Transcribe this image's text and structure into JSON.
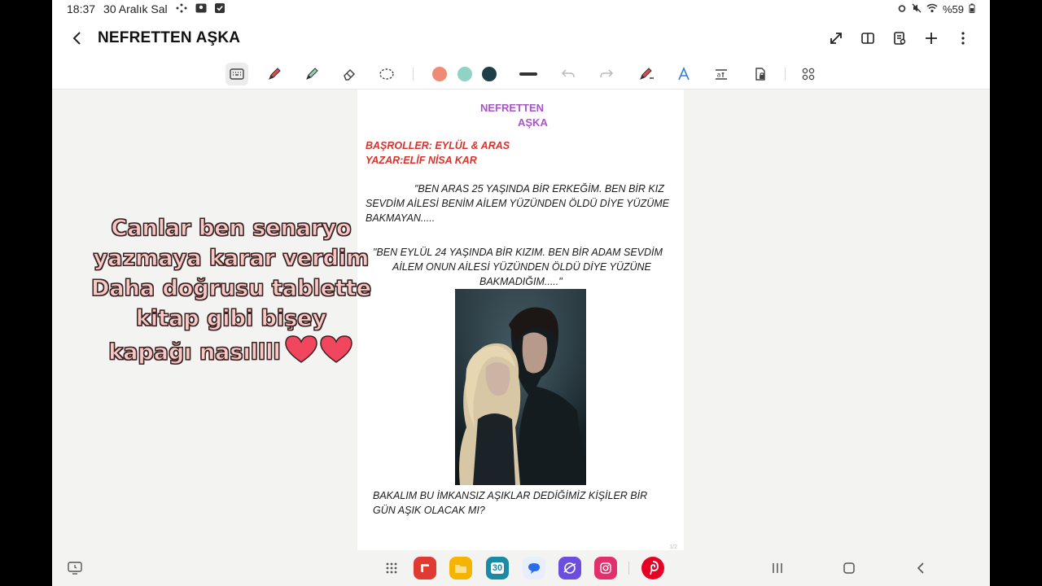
{
  "status_bar": {
    "time": "18:37",
    "date": "30 Aralık Sal",
    "battery": "%59"
  },
  "header": {
    "title": "NEFRETTEN AŞKA"
  },
  "toolbar": {
    "colors": [
      "#ef8a75",
      "#8fd3c4",
      "#1f3e47"
    ]
  },
  "page": {
    "title_line1": "NEFRETTEN",
    "title_line2": "AŞKA",
    "cast": "BAŞROLLER: EYLÜL & ARAS",
    "author": "YAZAR:ELİF NİSA KAR",
    "para1_line1": "\"BEN ARAS 25 YAŞINDA BİR ERKEĞİM. BEN BİR KIZ",
    "para1_line2": "SEVDİM AİLESİ BENİM AİLEM YÜZÜNDEN ÖLDÜ DİYE YÜZÜME",
    "para1_line3": "BAKMAYAN.....",
    "para2_line1": "\"BEN EYLÜL 24 YAŞINDA BİR KIZIM. BEN BİR ADAM SEVDİM",
    "para2_line2": "AİLEM ONUN AİLESİ YÜZÜNDEN ÖLDÜ DİYE YÜZÜNE",
    "para2_line3": "BAKMADIĞIM.....\"",
    "closing_line1": "BAKALIM BU İMKANSIZ AŞIKLAR DEDİĞİMİZ KİŞİLER BİR",
    "closing_line2": "GÜN AŞIK OLACAK MI?",
    "page_number": "1/2"
  },
  "caption": {
    "line1": "Canlar ben senaryo",
    "line2": "yazmaya karar verdim",
    "line3": "Daha doğrusu tablette",
    "line4": "kitap gibi bişey",
    "line5": "kapağı nasıllll"
  },
  "dock": {
    "apps": [
      "flipboard",
      "files",
      "calendar",
      "messages",
      "internet",
      "instagram",
      "pinterest"
    ],
    "calendar_day": "30"
  }
}
